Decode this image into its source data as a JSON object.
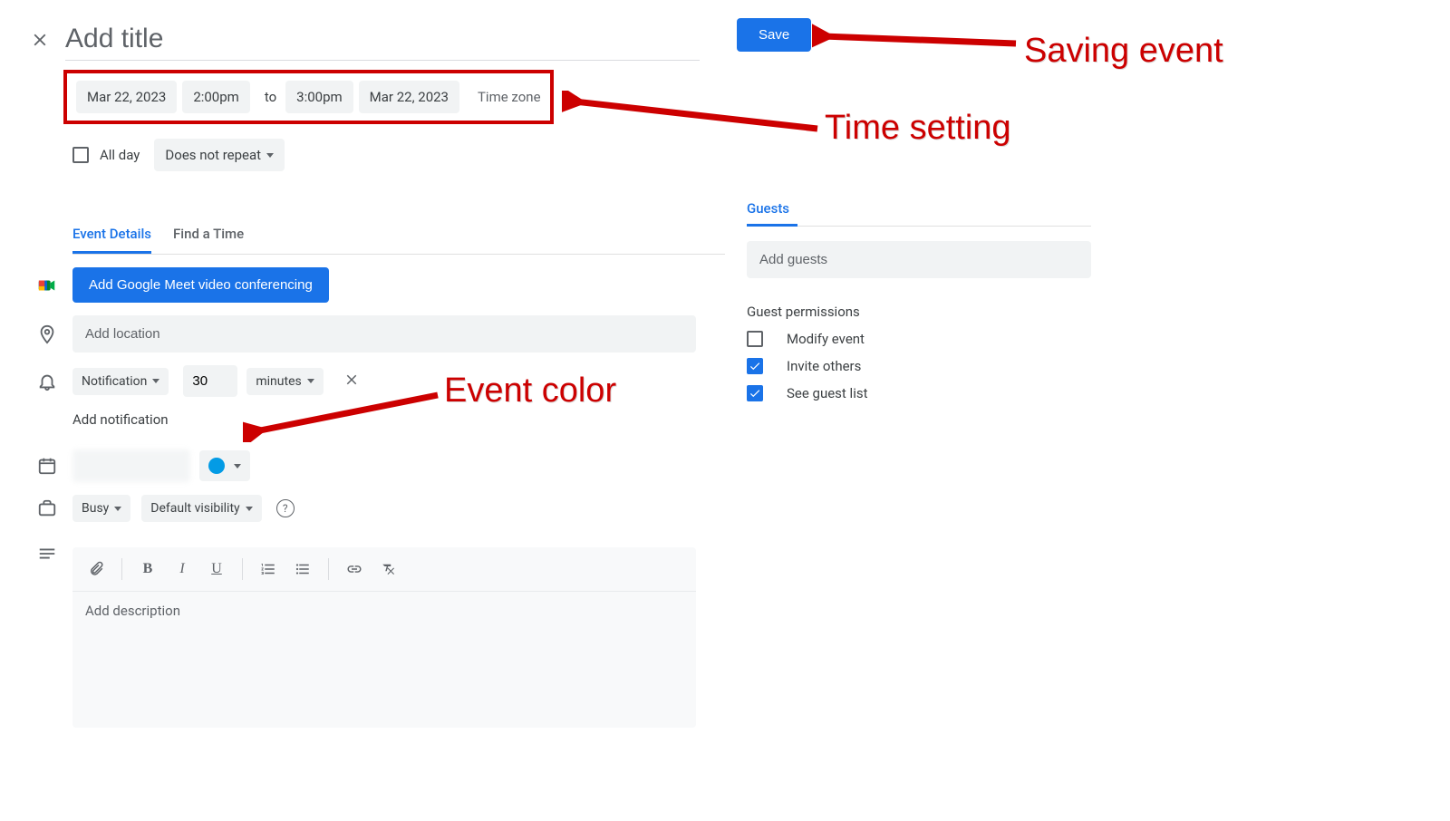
{
  "header": {
    "title_placeholder": "Add title",
    "save_label": "Save"
  },
  "time": {
    "start_date": "Mar 22, 2023",
    "start_time": "2:00pm",
    "to": "to",
    "end_time": "3:00pm",
    "end_date": "Mar 22, 2023",
    "timezone_label": "Time zone",
    "all_day_label": "All day",
    "repeat_label": "Does not repeat"
  },
  "tabs": {
    "details": "Event Details",
    "find": "Find a Time"
  },
  "meet": {
    "button_label": "Add Google Meet video conferencing"
  },
  "location": {
    "placeholder": "Add location"
  },
  "notification": {
    "type_label": "Notification",
    "value": "30",
    "unit_label": "minutes",
    "add_label": "Add notification"
  },
  "color": {
    "value": "#039be5"
  },
  "visibility": {
    "busy_label": "Busy",
    "visibility_label": "Default visibility"
  },
  "description": {
    "placeholder": "Add description"
  },
  "guests": {
    "header": "Guests",
    "placeholder": "Add guests",
    "permissions_title": "Guest permissions",
    "modify_label": "Modify event",
    "invite_label": "Invite others",
    "see_list_label": "See guest list"
  },
  "annotations": {
    "saving": "Saving event",
    "time_setting": "Time setting",
    "event_color": "Event color"
  }
}
